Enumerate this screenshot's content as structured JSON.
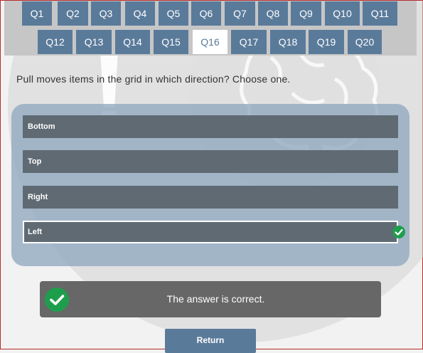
{
  "nav": {
    "row1": [
      "Q1",
      "Q2",
      "Q3",
      "Q4",
      "Q5",
      "Q6",
      "Q7",
      "Q8",
      "Q9",
      "Q10",
      "Q11"
    ],
    "row2": [
      "Q12",
      "Q13",
      "Q14",
      "Q15",
      "Q16",
      "Q17",
      "Q18",
      "Q19",
      "Q20"
    ],
    "active": "Q16"
  },
  "question": "Pull moves items in the grid in which direction? Choose one.",
  "options": [
    "Bottom",
    "Top",
    "Right",
    "Left"
  ],
  "selected_option": "Left",
  "result": {
    "message": "The answer is correct.",
    "icon": "check-circle-icon"
  },
  "return_label": "Return",
  "colors": {
    "button": "#5a7a9a",
    "option": "#5f6a73",
    "success": "#1e9e4c",
    "panel": "#8ca5be"
  }
}
